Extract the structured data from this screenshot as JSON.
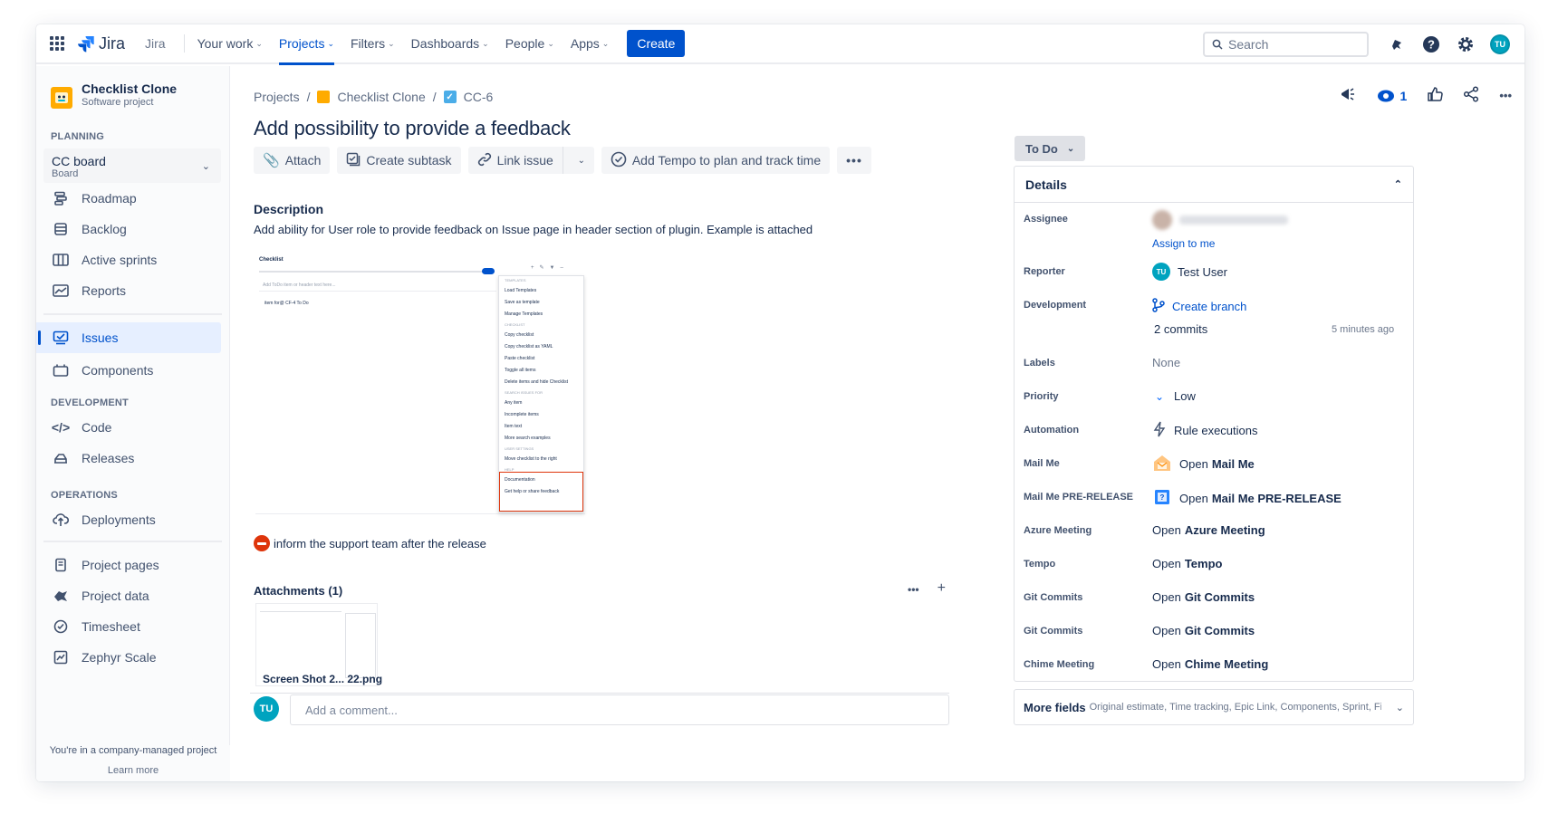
{
  "topnav": {
    "product": "Jira",
    "product_secondary": "Jira",
    "items": [
      {
        "label": "Your work"
      },
      {
        "label": "Projects"
      },
      {
        "label": "Filters"
      },
      {
        "label": "Dashboards"
      },
      {
        "label": "People"
      },
      {
        "label": "Apps"
      }
    ],
    "create_label": "Create",
    "search_placeholder": "Search",
    "avatar_initials": "TU",
    "accent": "#0052cc"
  },
  "sidebar": {
    "project_name": "Checklist Clone",
    "project_type": "Software project",
    "planning_title": "PLANNING",
    "board_name": "CC board",
    "board_sub": "Board",
    "planning_items": [
      {
        "label": "Roadmap",
        "icon": "roadmap-icon"
      },
      {
        "label": "Backlog",
        "icon": "backlog-icon"
      },
      {
        "label": "Active sprints",
        "icon": "sprints-icon"
      },
      {
        "label": "Reports",
        "icon": "reports-icon"
      }
    ],
    "issues_label": "Issues",
    "components_label": "Components",
    "development_title": "DEVELOPMENT",
    "development_items": [
      {
        "label": "Code",
        "icon": "code-icon"
      },
      {
        "label": "Releases",
        "icon": "releases-icon"
      }
    ],
    "operations_title": "OPERATIONS",
    "deployments_label": "Deployments",
    "extra_items": [
      {
        "label": "Project pages",
        "icon": "pages-icon"
      },
      {
        "label": "Project data",
        "icon": "data-icon"
      },
      {
        "label": "Timesheet",
        "icon": "timesheet-icon"
      },
      {
        "label": "Zephyr Scale",
        "icon": "zephyr-icon"
      }
    ],
    "footer_text": "You're in a company-managed project",
    "footer_link": "Learn more"
  },
  "issue": {
    "breadcrumb": [
      "Projects",
      "Checklist Clone",
      "CC-6"
    ],
    "title": "Add possibility to provide a feedback",
    "toolbar": {
      "attach": "Attach",
      "create_subtask": "Create subtask",
      "link_issue": "Link issue",
      "tempo": "Add Tempo to plan and track time"
    },
    "description_heading": "Description",
    "description_text": "Add ability for User role to provide feedback on Issue page in header section of plugin. Example is attached",
    "embedded": {
      "checklist_title": "Checklist",
      "input_placeholder": "Add ToDo item or header text here...",
      "item": "item for@ CF-4  To Do",
      "menu": [
        {
          "label": "TEMPLATES",
          "heading": true
        },
        {
          "label": "Load Templates"
        },
        {
          "label": "Save as template"
        },
        {
          "label": "Manage Templates"
        },
        {
          "label": "CHECKLIST",
          "heading": true
        },
        {
          "label": "Copy checklist"
        },
        {
          "label": "Copy checklist as YAML"
        },
        {
          "label": "Paste checklist"
        },
        {
          "label": "Toggle all items"
        },
        {
          "label": "Delete items and hide Checklist"
        },
        {
          "label": "SEARCH ISSUES FOR",
          "heading": true
        },
        {
          "label": "Any item"
        },
        {
          "label": "Incomplete items"
        },
        {
          "label": "Item text"
        },
        {
          "label": "More search examples"
        },
        {
          "label": "USER SETTINGS",
          "heading": true
        },
        {
          "label": "Move checklist to the right"
        },
        {
          "label": "HELP",
          "heading": true
        },
        {
          "label": "Documentation"
        },
        {
          "label": "Get help or share feedback"
        }
      ]
    },
    "note": "inform the support team after the release",
    "attachments_heading": "Attachments (1)",
    "attachment_name": "Screen Shot 2... 22.png",
    "comment_avatar": "TU",
    "comment_placeholder": "Add a comment..."
  },
  "right": {
    "watch_count": "1",
    "status": "To Do",
    "details_title": "Details",
    "assign_to_me": "Assign to me",
    "fields": {
      "assignee": "Assignee",
      "reporter": "Reporter",
      "reporter_value": "Test User",
      "development": "Development",
      "create_branch": "Create branch",
      "commits": "2 commits",
      "commits_time": "5 minutes ago",
      "labels": "Labels",
      "labels_value": "None",
      "priority": "Priority",
      "priority_value": "Low",
      "automation": "Automation",
      "automation_value": "Rule executions",
      "mail_me": "Mail Me",
      "mail_me_value_prefix": "Open",
      "mail_me_value": "Mail Me",
      "mail_me_pre": "Mail Me PRE-RELEASE",
      "mail_me_pre_value": "Mail Me PRE-RELEASE",
      "azure": "Azure Meeting",
      "azure_value": "Azure Meeting",
      "tempo": "Tempo",
      "tempo_value": "Tempo",
      "git1": "Git Commits",
      "git1_value": "Git Commits",
      "git2": "Git Commits",
      "git2_value": "Git Commits",
      "chime": "Chime Meeting",
      "chime_value": "Chime Meeting"
    },
    "more_fields": "More fields",
    "more_fields_sub": "Original estimate, Time tracking, Epic Link, Components, Sprint, Fi..."
  }
}
